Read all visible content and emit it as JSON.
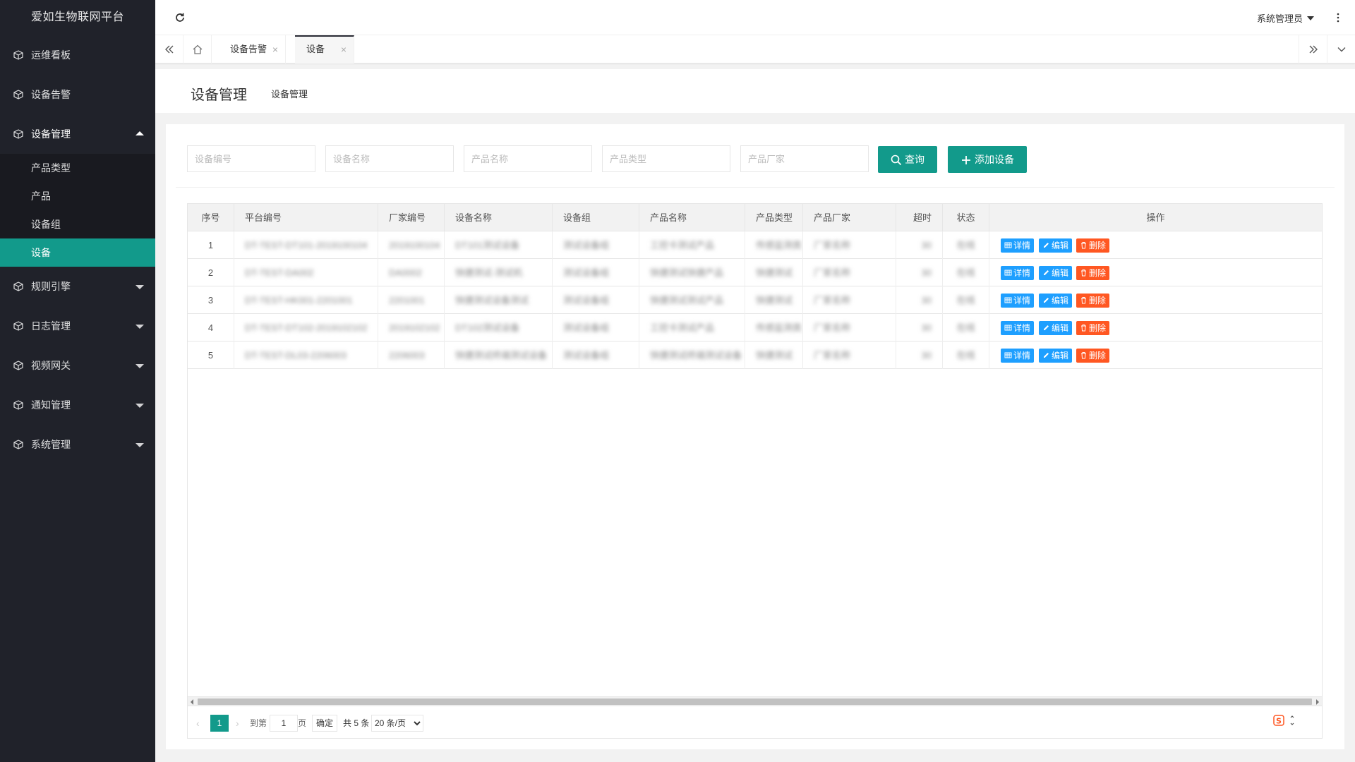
{
  "app": {
    "title": "爱如生物联网平台"
  },
  "sidebar": {
    "items": [
      {
        "label": "运维看板",
        "icon": "cube-icon",
        "expandable": false
      },
      {
        "label": "设备告警",
        "icon": "cube-icon",
        "expandable": false
      },
      {
        "label": "设备管理",
        "icon": "cube-icon",
        "expandable": true,
        "expanded": true,
        "children": [
          "产品类型",
          "产品",
          "设备组",
          "设备"
        ],
        "active_child": "设备"
      },
      {
        "label": "规则引擎",
        "icon": "cube-icon",
        "expandable": true
      },
      {
        "label": "日志管理",
        "icon": "cube-icon",
        "expandable": true
      },
      {
        "label": "视频网关",
        "icon": "cube-icon",
        "expandable": true
      },
      {
        "label": "通知管理",
        "icon": "cube-icon",
        "expandable": true
      },
      {
        "label": "系统管理",
        "icon": "cube-icon",
        "expandable": true
      }
    ]
  },
  "header": {
    "user": "系统管理员"
  },
  "tabs": [
    {
      "label": "设备告警",
      "active": false
    },
    {
      "label": "设备",
      "active": true
    }
  ],
  "page": {
    "title": "设备管理",
    "breadcrumb": "设备管理"
  },
  "search": {
    "device_code_placeholder": "设备编号",
    "device_name_placeholder": "设备名称",
    "product_name_placeholder": "产品名称",
    "product_type_placeholder": "产品类型",
    "vendor_placeholder": "产品厂家",
    "query_label": "查询",
    "add_label": "添加设备"
  },
  "table": {
    "columns": [
      "序号",
      "平台编号",
      "厂家编号",
      "设备名称",
      "设备组",
      "产品名称",
      "产品类型",
      "产品厂家",
      "超时",
      "状态",
      "操作"
    ],
    "rows": [
      [
        "1",
        "DT-TEST-DT101-2019100104",
        "2019100104",
        "DT101测试设备",
        "测试设备组",
        "工控卡测试产品",
        "传感监测类",
        "厂家名称",
        "30",
        "在线"
      ],
      [
        "2",
        "DT-TEST-DA002",
        "DA0002",
        "快捷测试-测试机",
        "测试设备组",
        "快捷测试快捷产品",
        "快捷测试",
        "厂家名称",
        "30",
        "在线"
      ],
      [
        "3",
        "DT-TEST-HK001-2201001",
        "2201001",
        "快捷测试设备测试",
        "测试设备组",
        "快捷测试测试产品",
        "快捷测试",
        "厂家名称",
        "30",
        "在线"
      ],
      [
        "4",
        "DT-TEST-DT102-2019102102",
        "2019102102",
        "DT102测试设备",
        "测试设备组",
        "工控卡测试产品",
        "传感监测类",
        "厂家名称",
        "30",
        "在线"
      ],
      [
        "5",
        "DT-TEST-DL03-2206003",
        "2206003",
        "快捷测试终端测试设备",
        "测试设备组",
        "快捷测试终端测试设备",
        "快捷测试",
        "厂家名称",
        "30",
        "在线"
      ]
    ],
    "actions": {
      "detail": "详情",
      "edit": "编辑",
      "delete": "删除"
    }
  },
  "pager": {
    "current_page": "1",
    "goto_label": "到第",
    "page_unit": "页",
    "confirm_label": "确定",
    "total_label": "共 5 条",
    "page_size": "20 条/页"
  },
  "colors": {
    "accent": "#129a8b",
    "sidebar_bg": "#20222a",
    "blue": "#1e9fff",
    "red": "#ff5722"
  }
}
